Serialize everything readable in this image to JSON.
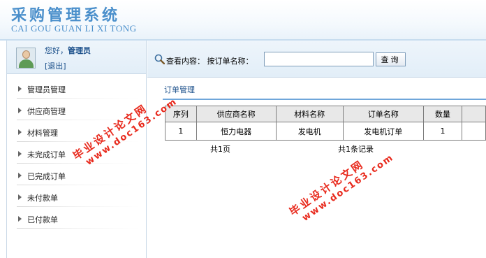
{
  "header": {
    "title": "采购管理系统",
    "subtitle": "CAI GOU GUAN LI XI TONG"
  },
  "user": {
    "greeting_prefix": "您好，",
    "username": "管理员",
    "logout_label": "[退出]"
  },
  "sidebar": {
    "items": [
      {
        "label": "管理员管理"
      },
      {
        "label": "供应商管理"
      },
      {
        "label": "材料管理"
      },
      {
        "label": "未完成订单"
      },
      {
        "label": "已完成订单"
      },
      {
        "label": "未付款单"
      },
      {
        "label": "已付款单"
      }
    ]
  },
  "search": {
    "label": "查看内容：  按订单名称：",
    "value": "",
    "button_label": "查询"
  },
  "section": {
    "title": "订单管理"
  },
  "table": {
    "columns": [
      "序列",
      "供应商名称",
      "材料名称",
      "订单名称",
      "数量",
      ""
    ],
    "rows": [
      [
        "1",
        "恒力电器",
        "发电机",
        "发电机订单",
        "1",
        ""
      ]
    ]
  },
  "pager": {
    "pages_text": "共1页",
    "records_text": "共1条记录"
  },
  "watermarks": [
    {
      "cn": "毕业设计论文网",
      "url": "www.doc163.com"
    },
    {
      "cn": "毕业设计论文网",
      "url": "www.doc163.com"
    }
  ],
  "colors": {
    "brand": "#4a8fcb",
    "link": "#1a4f8a",
    "accent_rule": "#6fa6da",
    "watermark": "#e8291c"
  }
}
